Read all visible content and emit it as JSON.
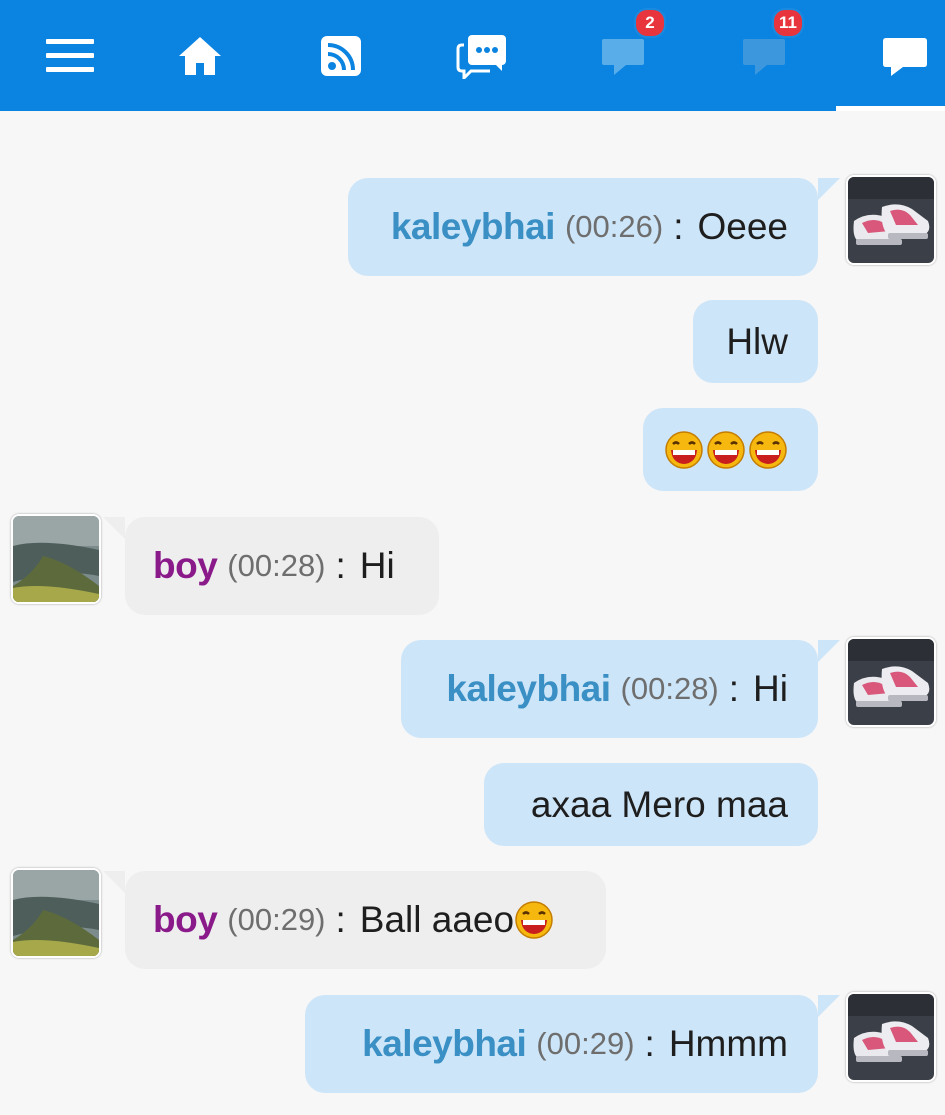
{
  "nav": {
    "items": [
      {
        "icon": "menu-icon"
      },
      {
        "icon": "home-icon"
      },
      {
        "icon": "rss-icon"
      },
      {
        "icon": "chatrooms-icon"
      },
      {
        "icon": "chat-bubble-icon",
        "badge": "2"
      },
      {
        "icon": "chat-bubble-icon",
        "badge": "11"
      },
      {
        "icon": "message-icon",
        "active": true
      }
    ]
  },
  "messages": [
    {
      "user": "kaleybhai",
      "time": "(00:26)",
      "sep": ":",
      "text": "Oeee"
    },
    {
      "text": "Hlw"
    },
    {
      "emoji": "grinning-emoji",
      "count": 3
    },
    {
      "user": "boy",
      "time": "(00:28)",
      "sep": ":",
      "text": "Hi"
    },
    {
      "user": "kaleybhai",
      "time": "(00:28)",
      "sep": ":",
      "text": "Hi"
    },
    {
      "text": "axaa Mero maa"
    },
    {
      "user": "boy",
      "time": "(00:29)",
      "sep": ":",
      "text": "Ball aaeo",
      "emoji": "grinning-emoji"
    },
    {
      "user": "kaleybhai",
      "time": "(00:29)",
      "sep": ":",
      "text": "Hmmm"
    }
  ],
  "colors": {
    "topbar": "#0a84e0",
    "outgoing_bubble": "#cde5f8",
    "incoming_bubble": "#eeeeee",
    "self_name": "#3a8fc4",
    "other_name": "#8a1a8a",
    "badge": "#e8353d"
  }
}
